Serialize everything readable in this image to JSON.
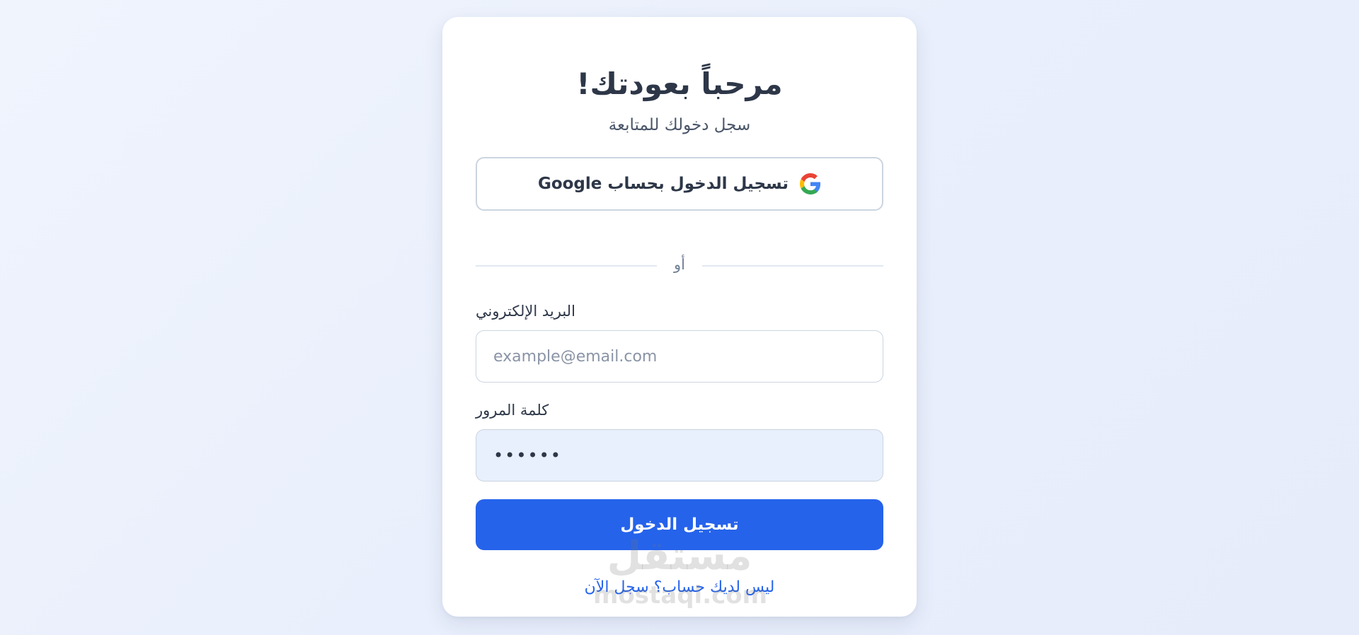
{
  "header": {
    "title": "مرحباً بعودتك!",
    "subtitle": "سجل دخولك للمتابعة"
  },
  "google_login": {
    "label": "تسجيل الدخول بحساب Google",
    "icon": "google-icon"
  },
  "divider": {
    "text": "أو"
  },
  "form": {
    "email": {
      "label": "البريد الإلكتروني",
      "value": "",
      "placeholder": "example@email.com"
    },
    "password": {
      "label": "كلمة المرور",
      "value": "••••••"
    },
    "submit_label": "تسجيل الدخول"
  },
  "footer": {
    "signup_text": "ليس لديك حساب؟ سجل الآن"
  },
  "watermark": {
    "arabic": "مستقل",
    "latin": "mostaql.com"
  },
  "colors": {
    "primary": "#2563eb",
    "background": "#eef2fc",
    "card": "#ffffff",
    "text": "#2d3748",
    "password_field_bg": "#e8effd"
  }
}
